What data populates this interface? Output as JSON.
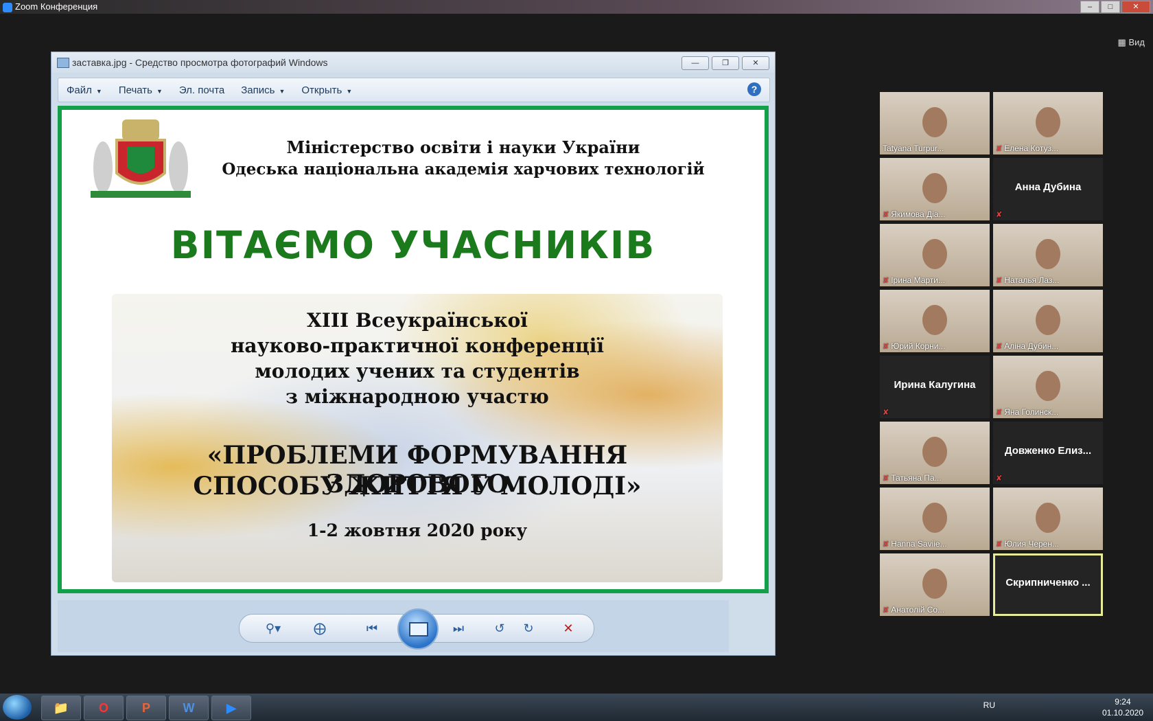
{
  "zoom": {
    "title": "Zoom Конференция",
    "view_label": "Вид",
    "colors": {
      "background": "#1a1a1a",
      "active_border": "#e8ec9a",
      "mic_muted": "#e04040"
    }
  },
  "viewer": {
    "title": "заставка.jpg - Средство просмотра фотографий Windows",
    "menu": [
      {
        "label": "Файл",
        "has_caret": true
      },
      {
        "label": "Печать",
        "has_caret": true
      },
      {
        "label": "Эл. почта",
        "has_caret": false
      },
      {
        "label": "Запись",
        "has_caret": true
      },
      {
        "label": "Открыть",
        "has_caret": true
      }
    ],
    "help_glyph": "?",
    "icons": [
      "zoom-icon",
      "fit-window-icon",
      "previous-icon",
      "slideshow-icon",
      "next-icon",
      "rotate-left-icon",
      "rotate-right-icon",
      "delete-icon"
    ]
  },
  "slide": {
    "ministry": "Міністерство освіти і науки України",
    "academy": "Одеська національна академія харчових технологій",
    "welcome": "ВІТАЄМО УЧАСНИКІВ",
    "conf_line1": "XIII Всеукраїнської",
    "conf_line2": "науково-практичної конференції",
    "conf_line3": "молодих учених та студентів",
    "conf_line4": "з міжнародною участю",
    "topic_line1": "«ПРОБЛЕМИ ФОРМУВАННЯ ЗДОРОВОГО",
    "topic_line2": "СПОСОБУ ЖИТТЯ У МОЛОДІ»",
    "dates": "1-2 жовтня 2020 року",
    "accent": "#12a04a",
    "welcome_color": "#1b7a1b"
  },
  "participants": [
    {
      "name": "Tatyana Turpur...",
      "video": true,
      "muted": false
    },
    {
      "name": "Елена Котуз...",
      "video": true,
      "muted": true
    },
    {
      "name": "Якимова Діа...",
      "video": true,
      "muted": true
    },
    {
      "name": "Анна Дубина",
      "video": false,
      "muted": true
    },
    {
      "name": "Ірина Марти...",
      "video": true,
      "muted": true
    },
    {
      "name": "Наталья Лаз...",
      "video": true,
      "muted": true
    },
    {
      "name": "Юрий Корни...",
      "video": true,
      "muted": true
    },
    {
      "name": "Аліна Дубин...",
      "video": true,
      "muted": true
    },
    {
      "name": "Ирина Калугина",
      "video": false,
      "muted": true
    },
    {
      "name": "Яна Голинск...",
      "video": true,
      "muted": true
    },
    {
      "name": "Татьяна Па...",
      "video": true,
      "muted": true
    },
    {
      "name": "Довженко Елиз...",
      "video": false,
      "muted": true
    },
    {
      "name": "Hanna Saviie...",
      "video": true,
      "muted": true
    },
    {
      "name": "Юлия Черен...",
      "video": true,
      "muted": true
    },
    {
      "name": "Анатолій Со...",
      "video": true,
      "muted": true
    },
    {
      "name": "Скрипниченко ...",
      "video": false,
      "muted": false,
      "active": true
    }
  ],
  "taskbar": {
    "apps": [
      "explorer-icon",
      "opera-icon",
      "powerpoint-icon",
      "word-icon",
      "zoom-app-icon"
    ],
    "language": "RU",
    "time": "9:24",
    "date": "01.10.2020"
  }
}
